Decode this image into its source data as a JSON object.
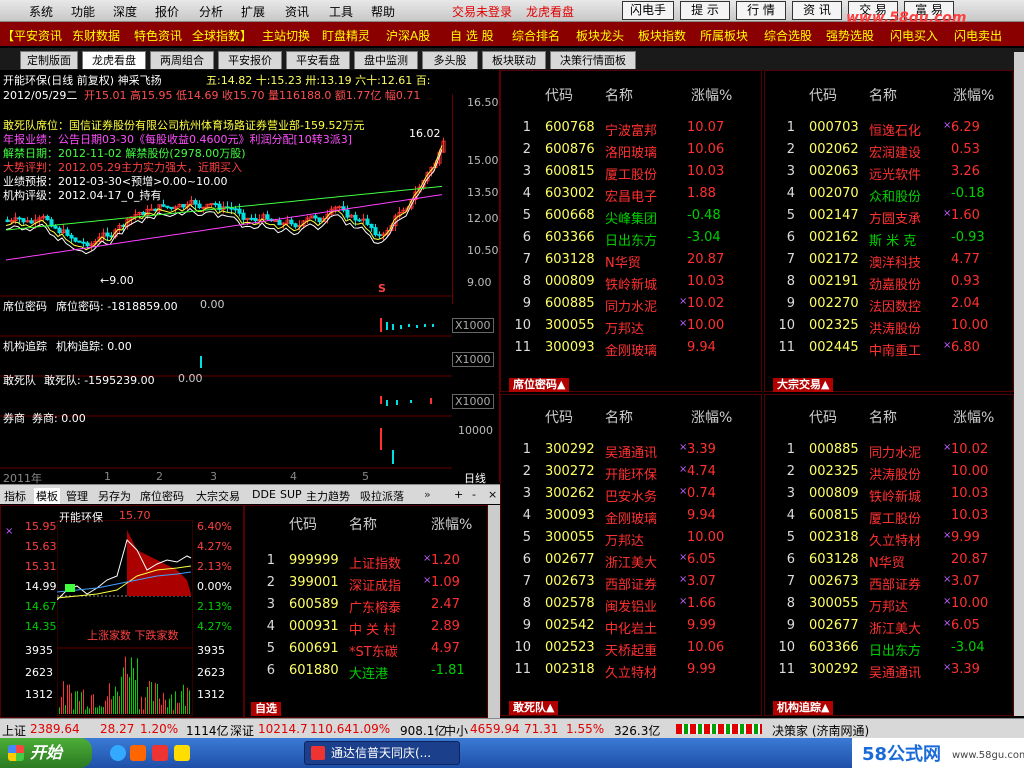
{
  "menubar": {
    "items": [
      "系统",
      "功能",
      "深度",
      "报价",
      "分析",
      "扩展",
      "资讯",
      "工具",
      "帮助"
    ],
    "status_login": "交易未登录",
    "status_view": "龙虎看盘",
    "buttons": [
      "闪电手",
      "提 示",
      "行 情",
      "资 讯",
      "交 易",
      "富 易"
    ],
    "watermark": "www.58gu.com"
  },
  "linkbar": [
    "【平安资讯",
    "东财数据",
    "特色资讯",
    "全球指数】",
    "主站切换",
    "盯盘精灵",
    "沪深A股",
    "自 选 股",
    "综合排名",
    "板块龙头",
    "板块指数",
    "所属板块",
    "综合选股",
    "强势选股",
    "闪电买入",
    "闪电卖出"
  ],
  "tabs": [
    "定制版面",
    "龙虎看盘",
    "两周组合",
    "平安报价",
    "平安看盘",
    "盘中监测",
    "多头股",
    "板块联动",
    "决策行情面板"
  ],
  "kline": {
    "header1": "开能环保(日线 前复权) 神采飞扬",
    "header1b": "五:14.82 十:15.23 卅:13.19 六十:12.61 百:",
    "date": "2012/05/29二",
    "ohlc": "开15.01 高15.95 低14.69 收15.70 量116188.0 额1.77亿 幅0.71",
    "note1": "敢死队席位：国信证券股份有限公司杭州体育场路证券营业部-159.52万元",
    "note2": "年报业绩：公告日期03-30《每股收益0.4600元》利润分配[10转3派3]",
    "note3": "解禁日期：2012-11-02 解禁股份(2978.00万股)",
    "note4": "大势评判：2012.05.29主力实力强大，近期买入",
    "note5": "业绩预报：2012-03-30<预增>0.00~10.00",
    "note6": "机构评级：2012.04-17_0_持有",
    "price_hi": "16.02",
    "price_lo": "←9.00",
    "y_labels": [
      "16.50",
      "15.00",
      "13.50",
      "12.00",
      "10.50",
      "9.00"
    ],
    "marker": "S",
    "ind1_title": "席位密码",
    "ind1_val": "席位密码: -1818859.00",
    "ind1_zero": "0.00",
    "ind2_title": "机构追踪",
    "ind2_val": "机构追踪: 0.00",
    "ind3_title": "敢死队",
    "ind3_val": "敢死队: -1595239.00",
    "ind3_zero": "0.00",
    "ind4_title": "券商",
    "ind4_val": "券商: 0.00",
    "x1000": "X1000",
    "ind4_10000": "10000",
    "year": "2011年",
    "months": [
      "1",
      "2",
      "3",
      "4",
      "5"
    ],
    "period": "日线"
  },
  "subtabs": [
    "指标",
    "模板",
    "管理",
    "另存为",
    "席位密码",
    "大宗交易",
    "DDE",
    "SUP",
    "主力趋势",
    "吸拉派落"
  ],
  "mini": {
    "name": "开能环保",
    "price": "15.70",
    "left": [
      "15.95",
      "15.63",
      "15.31",
      "14.99",
      "14.67",
      "14.35",
      "3935",
      "2623",
      "1312"
    ],
    "right": [
      "6.40%",
      "4.27%",
      "2.13%",
      "0.00%",
      "2.13%",
      "4.27%",
      "3935",
      "2623",
      "1312"
    ],
    "up_down": "上涨家数 下跌家数"
  },
  "headers": {
    "code": "代码",
    "name": "名称",
    "chg": "涨幅%"
  },
  "tables": {
    "seat": {
      "tab": "席位密码▲",
      "rows": [
        [
          "1",
          "600768",
          "宁波富邦",
          "",
          "10.07",
          "up"
        ],
        [
          "2",
          "600876",
          "洛阳玻璃",
          "",
          "10.06",
          "up"
        ],
        [
          "3",
          "600815",
          "厦工股份",
          "",
          "10.03",
          "up"
        ],
        [
          "4",
          "603002",
          "宏昌电子",
          "",
          "1.88",
          "up"
        ],
        [
          "5",
          "600668",
          "尖峰集团",
          "",
          "-0.48",
          "dn"
        ],
        [
          "6",
          "603366",
          "日出东方",
          "",
          "-3.04",
          "dn"
        ],
        [
          "7",
          "603128",
          "N华贸",
          "",
          "20.87",
          "up"
        ],
        [
          "8",
          "000809",
          "铁岭新城",
          "",
          "10.03",
          "up"
        ],
        [
          "9",
          "600885",
          "同力水泥",
          "×",
          "10.02",
          "up"
        ],
        [
          "10",
          "300055",
          "万邦达",
          "×",
          "10.00",
          "up"
        ],
        [
          "11",
          "300093",
          "金刚玻璃",
          "",
          "9.94",
          "up"
        ]
      ]
    },
    "block": {
      "tab": "大宗交易▲",
      "rows": [
        [
          "1",
          "000703",
          "恒逸石化",
          "×",
          "6.29",
          "up"
        ],
        [
          "2",
          "002062",
          "宏润建设",
          "",
          "0.53",
          "up"
        ],
        [
          "3",
          "002063",
          "远光软件",
          "",
          "3.26",
          "up"
        ],
        [
          "4",
          "002070",
          "众和股份",
          "",
          "-0.18",
          "dn"
        ],
        [
          "5",
          "002147",
          "方圆支承",
          "×",
          "1.60",
          "up"
        ],
        [
          "6",
          "002162",
          "斯 米 克",
          "",
          "-0.93",
          "dn"
        ],
        [
          "7",
          "002172",
          "澳洋科技",
          "",
          "4.77",
          "up"
        ],
        [
          "8",
          "002191",
          "劲嘉股份",
          "",
          "0.93",
          "up"
        ],
        [
          "9",
          "002270",
          "法因数控",
          "",
          "2.04",
          "up"
        ],
        [
          "10",
          "002325",
          "洪涛股份",
          "",
          "10.00",
          "up"
        ],
        [
          "11",
          "002445",
          "中南重工",
          "×",
          "6.80",
          "up"
        ]
      ]
    },
    "dare": {
      "tab": "敢死队▲",
      "rows": [
        [
          "1",
          "300292",
          "吴通通讯",
          "×",
          "3.39",
          "up"
        ],
        [
          "2",
          "300272",
          "开能环保",
          "×",
          "4.74",
          "up"
        ],
        [
          "3",
          "300262",
          "巴安水务",
          "×",
          "0.74",
          "up"
        ],
        [
          "4",
          "300093",
          "金刚玻璃",
          "",
          "9.94",
          "up"
        ],
        [
          "5",
          "300055",
          "万邦达",
          "",
          "10.00",
          "up"
        ],
        [
          "6",
          "002677",
          "浙江美大",
          "×",
          "6.05",
          "up"
        ],
        [
          "7",
          "002673",
          "西部证券",
          "×",
          "3.07",
          "up"
        ],
        [
          "8",
          "002578",
          "闽发铝业",
          "×",
          "1.66",
          "up"
        ],
        [
          "9",
          "002542",
          "中化岩土",
          "",
          "9.99",
          "up"
        ],
        [
          "10",
          "002523",
          "天桥起重",
          "",
          "10.06",
          "up"
        ],
        [
          "11",
          "002318",
          "久立特材",
          "",
          "9.99",
          "up"
        ]
      ]
    },
    "inst": {
      "tab": "机构追踪▲",
      "rows": [
        [
          "1",
          "000885",
          "同力水泥",
          "×",
          "10.02",
          "up"
        ],
        [
          "2",
          "002325",
          "洪涛股份",
          "",
          "10.00",
          "up"
        ],
        [
          "3",
          "000809",
          "铁岭新城",
          "",
          "10.03",
          "up"
        ],
        [
          "4",
          "600815",
          "厦工股份",
          "",
          "10.03",
          "up"
        ],
        [
          "5",
          "002318",
          "久立特材",
          "×",
          "9.99",
          "up"
        ],
        [
          "6",
          "603128",
          "N华贸",
          "",
          "20.87",
          "up"
        ],
        [
          "7",
          "002673",
          "西部证券",
          "×",
          "3.07",
          "up"
        ],
        [
          "8",
          "300055",
          "万邦达",
          "×",
          "10.00",
          "up"
        ],
        [
          "9",
          "002677",
          "浙江美大",
          "×",
          "6.05",
          "up"
        ],
        [
          "10",
          "603366",
          "日出东方",
          "",
          "-3.04",
          "dn"
        ],
        [
          "11",
          "300292",
          "吴通通讯",
          "×",
          "3.39",
          "up"
        ]
      ]
    },
    "watch": {
      "tab": "自选",
      "rows": [
        [
          "1",
          "999999",
          "上证指数",
          "×",
          "1.20",
          "up"
        ],
        [
          "2",
          "399001",
          "深证成指",
          "×",
          "1.09",
          "up"
        ],
        [
          "3",
          "600589",
          "广东榕泰",
          "",
          "2.47",
          "up"
        ],
        [
          "4",
          "000931",
          "中 关 村",
          "",
          "2.89",
          "up"
        ],
        [
          "5",
          "600691",
          "*ST东碳",
          "",
          "4.97",
          "up"
        ],
        [
          "6",
          "601880",
          "大连港",
          "",
          "-1.81",
          "dn"
        ]
      ]
    }
  },
  "statusbar": {
    "sh_label": "上证",
    "sh_val": "2389.64",
    "sh_chg": "28.27",
    "sh_pct": "1.20%",
    "sh_amt": "1114亿",
    "sz_label": "深证",
    "sz_val": "10214.7",
    "sz_chg": "110.64",
    "sz_pct": "1.09%",
    "sz_amt": "908.1亿",
    "zx_label": "中小",
    "zx_val": "4659.94",
    "zx_chg": "71.31",
    "zx_pct": "1.55%",
    "zx_amt": "326.3亿",
    "app": "决策家 (济南网通)"
  },
  "taskbar": {
    "start": "开始",
    "task": "通达信普天同庆(...",
    "brand": "58公式网",
    "brand_url": "www.58gu.com"
  }
}
